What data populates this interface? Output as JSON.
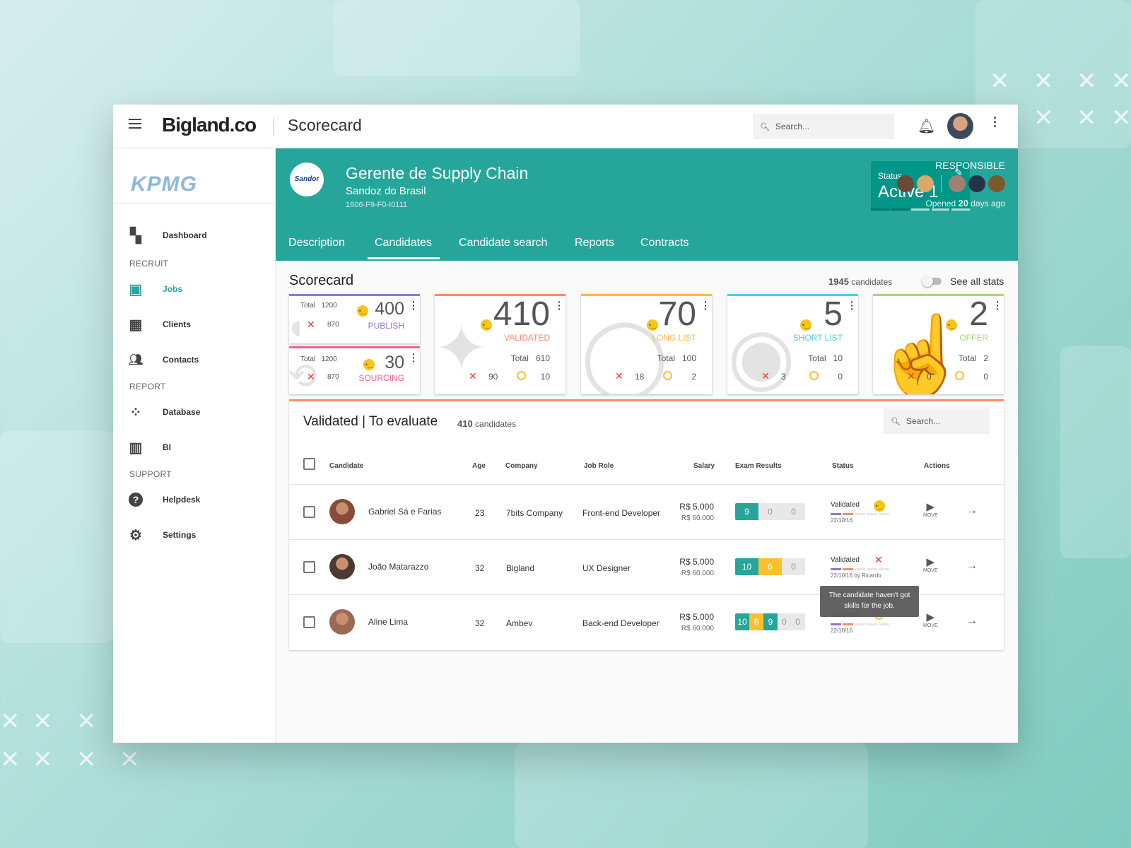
{
  "colors": {
    "teal": "#26a69a",
    "publish": "#9575cd",
    "sourcing": "#f06292",
    "validated": "#ff8a65",
    "long_list": "#ffb74d",
    "short_list": "#4dd0e1",
    "offer": "#aed581",
    "reject": "#e53935",
    "pending": "#fbc02d"
  },
  "topbar": {
    "menu_icon": "hamburger-icon",
    "logo": "Bigland.co",
    "title": "Scorecard",
    "search_placeholder": "Search...",
    "bell_icon": "bell-icon",
    "more_icon": "more-vert-icon"
  },
  "sidebar": {
    "client_logo": "KPMG",
    "items": [
      {
        "label": "Dashboard",
        "icon": "dashboard-icon"
      },
      {
        "section": "RECRUIT"
      },
      {
        "label": "Jobs",
        "icon": "badge-icon",
        "active": true
      },
      {
        "label": "Clients",
        "icon": "building-icon"
      },
      {
        "label": "Contacts",
        "icon": "people-icon"
      },
      {
        "section": "REPORT"
      },
      {
        "label": "Database",
        "icon": "bubbles-icon"
      },
      {
        "label": "BI",
        "icon": "bar-chart-icon"
      },
      {
        "section": "SUPPORT"
      },
      {
        "label": "Helpdesk",
        "icon": "help-icon"
      },
      {
        "label": "Settings",
        "icon": "gear-icon"
      }
    ]
  },
  "job": {
    "company_logo": "Sandoz Lifesciences",
    "title": "Gerente de Supply Chain",
    "company": "Sandoz do Brasil",
    "code": "1606-F9-F0-I0111",
    "status_label": "Status",
    "status_value": "Active 1",
    "status_steps": 5,
    "status_steps_done": 2,
    "responsible_label": "RESPONSIBLE",
    "opened_prefix": "Opened",
    "opened_days": "20",
    "opened_suffix": "days ago",
    "tabs": [
      "Description",
      "Candidates",
      "Candidate search",
      "Reports",
      "Contracts"
    ],
    "active_tab": "Candidates"
  },
  "scorecard": {
    "title": "Scorecard",
    "candidates_count": "1945",
    "candidates_label": "candidates",
    "see_all_label": "See all stats",
    "see_all_on": false,
    "stages": [
      {
        "name": "PUBLISH",
        "count": "400",
        "total_label": "Total",
        "total": "1200",
        "rejected": "870"
      },
      {
        "name": "SOURCING",
        "count": "30",
        "total_label": "Total",
        "total": "1200",
        "rejected": "870"
      },
      {
        "name": "VALIDATED",
        "count": "410",
        "total_label": "Total",
        "total": "610",
        "rejected": "90",
        "pending": "10"
      },
      {
        "name": "LONG LIST",
        "count": "70",
        "total_label": "Total",
        "total": "100",
        "rejected": "18",
        "pending": "2"
      },
      {
        "name": "SHORT LIST",
        "count": "5",
        "total_label": "Total",
        "total": "10",
        "rejected": "3",
        "pending": "0"
      },
      {
        "name": "OFFER",
        "count": "2",
        "total_label": "Total",
        "total": "2",
        "rejected": "0",
        "pending": "0"
      }
    ]
  },
  "table": {
    "title": "Validated | To evaluate",
    "count": "410",
    "count_label": "candidates",
    "search_placeholder": "Search...",
    "columns": [
      "Candidate",
      "Age",
      "Company",
      "Job Role",
      "Salary",
      "Exam Results",
      "Status",
      "Actions"
    ],
    "rows": [
      {
        "name": "Gabriel Sá e Farias",
        "age": "23",
        "company": "7bits Company",
        "role": "Front-end Developer",
        "salary": "R$ 5.000",
        "salary_max": "R$ 60.000",
        "exam": [
          "9",
          "0",
          "0"
        ],
        "status": "Validated",
        "status_date": "22/10/16",
        "status_icon": "thinking-emoji-icon",
        "move": "MOVE"
      },
      {
        "name": "João Matarazzo",
        "age": "32",
        "company": "Bigland",
        "role": "UX Designer",
        "salary": "R$ 5.000",
        "salary_max": "R$ 60.000",
        "exam": [
          "10",
          "6",
          "0"
        ],
        "status": "Validated",
        "status_date": "22/10/16 by Ricardo",
        "status_icon": "close-icon",
        "move": "MOVE"
      },
      {
        "name": "Aline Lima",
        "age": "32",
        "company": "Ambev",
        "role": "Back-end Developer",
        "salary": "R$ 5.000",
        "salary_max": "R$ 60.000",
        "exam": [
          "10",
          "6",
          "9",
          "0",
          "0"
        ],
        "status": "Validated",
        "status_date": "22/10/16",
        "status_icon": "circle-icon",
        "move": "MOVE"
      }
    ],
    "tooltip": "The candidate haven't got skills for the job."
  }
}
